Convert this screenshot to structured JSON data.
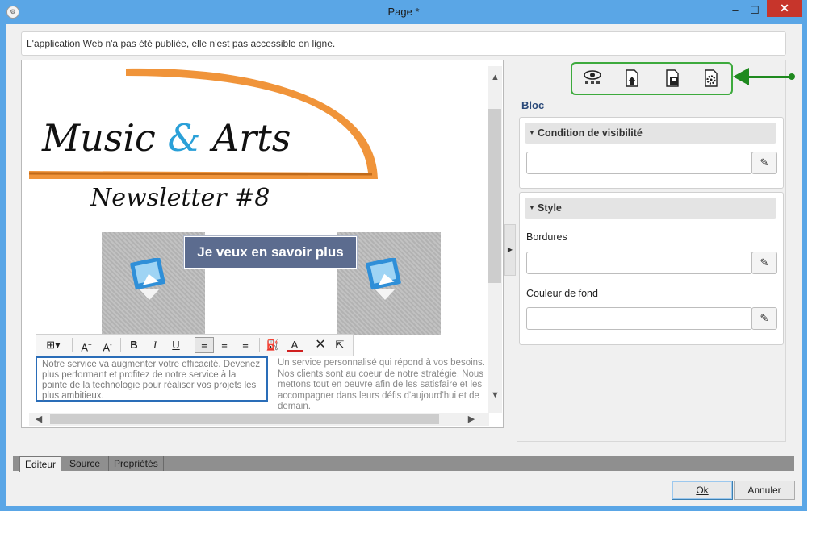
{
  "window": {
    "title": "Page *",
    "minimize": "–",
    "maximize": "☐",
    "close": "✕"
  },
  "info_bar": {
    "text": "L'application Web n'a pas été publiée, elle n'est pas accessible en ligne."
  },
  "editor": {
    "logo": {
      "word1": "Music ",
      "amp": "&",
      "word2": " Arts",
      "subtitle": "Newsletter #8"
    },
    "cta_button": "Je veux en savoir plus",
    "text_left": "Notre service va augmenter votre efficacité. Devenez plus performant et profitez de notre service à la pointe de la technologie pour réaliser vos projets les plus ambitieux.",
    "text_right": "Un service personnalisé qui répond à vos besoins. Nos clients sont au coeur de notre stratégie. Nous mettons tout en oeuvre afin de les satisfaire et les accompagner dans leurs défis d'aujourd'hui et de demain.",
    "toolbar": [
      "insert-block",
      "font-grow",
      "font-shrink",
      "bold",
      "italic",
      "underline",
      "align-left",
      "align-center",
      "align-right",
      "fill-color",
      "font-color",
      "remove",
      "link"
    ]
  },
  "panel": {
    "section_title": "Bloc",
    "visibility_group": {
      "title": "Condition de visibilité",
      "value": ""
    },
    "style_group": {
      "title": "Style",
      "borders_label": "Bordures",
      "borders_value": "",
      "background_label": "Couleur de fond",
      "background_value": ""
    },
    "icons": [
      "preview-icon",
      "export-page-icon",
      "save-page-icon",
      "page-settings-icon"
    ]
  },
  "bottom_tabs": {
    "editor": "Editeur",
    "source": "Source",
    "properties": "Propriétés",
    "selected": "Editeur"
  },
  "dialog_buttons": {
    "ok": "Ok",
    "cancel": "Annuler"
  },
  "colors": {
    "titlebar": "#5aa6e6",
    "accent_orange": "#f0943a",
    "accent_blue": "#2aa0d8",
    "cta": "#5c6c8f",
    "annotation_green": "#1f8a1f"
  }
}
